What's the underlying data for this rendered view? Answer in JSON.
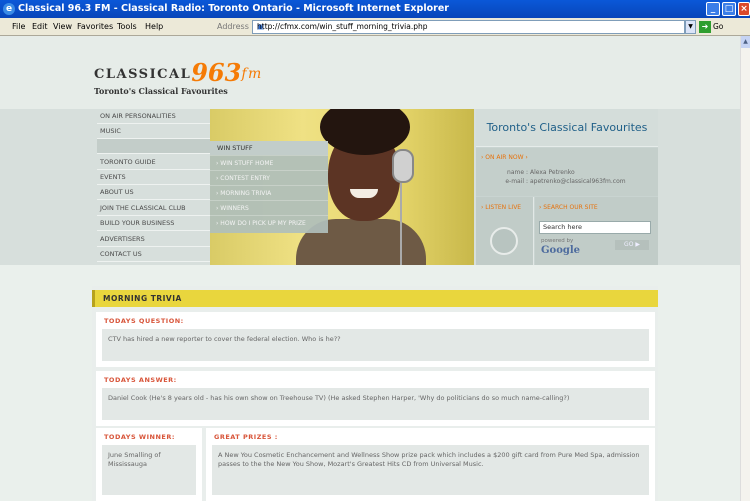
{
  "window": {
    "title": "Classical 96.3 FM - Classical Radio: Toronto Ontario - Microsoft Internet Explorer",
    "icon": "ie-icon"
  },
  "menubar": {
    "items": [
      "File",
      "Edit",
      "View",
      "Favorites",
      "Tools",
      "Help"
    ],
    "address_label": "Address",
    "address_url": "http://cfmx.com/win_stuff_morning_trivia.php",
    "go_label": "Go"
  },
  "logo": {
    "word": "CLASSICAL",
    "number": "963",
    "fm": "fm",
    "tagline": "Toronto's Classical Favourites"
  },
  "nav": {
    "items": [
      "ON AIR PERSONALITIES",
      "MUSIC",
      "",
      "TORONTO GUIDE",
      "EVENTS",
      "ABOUT US",
      "JOIN THE CLASSICAL CLUB",
      "BUILD YOUR BUSINESS",
      "ADVERTISERS",
      "CONTACT US"
    ]
  },
  "dropdown": {
    "title": "WIN STUFF",
    "items": [
      "› WIN STUFF HOME",
      "› CONTEST ENTRY",
      "› MORNING TRIVIA",
      "› WINNERS",
      "› HOW DO I PICK UP MY PRIZE"
    ]
  },
  "right_panel": {
    "title": "Toronto's Classical Favourites",
    "on_air_heading": "› ON AIR NOW ›",
    "name_label": "name :",
    "name_value": "Alexa Petrenko",
    "email_label": "e-mail :",
    "email_value": "apetrenko@classical963fm.com",
    "listen_live": "› LISTEN LIVE",
    "search_heading": "› SEARCH OUR SITE",
    "search_value": "Search here",
    "powered_by": "powered by",
    "google": "Google",
    "go_button": "GO ▶"
  },
  "content": {
    "section_title": "MORNING TRIVIA",
    "question_heading": "TODAYS QUESTION:",
    "question_text": "CTV has hired a new reporter to cover the federal election. Who is he??",
    "answer_heading": "TODAYS ANSWER:",
    "answer_text": "Daniel Cook (He's 8 years old - has his own show on Treehouse TV) (He asked Stephen Harper, 'Why do politicians do so much name-calling?)",
    "winner_heading": "TODAYS WINNER:",
    "winner_text": "June Smalling of Mississauga",
    "prizes_heading": "GREAT PRIZES :",
    "prizes_text": "A New You Cosmetic Enchancement and Wellness Show prize pack which includes a $200 gift card from Pure Med Spa, admission passes to the the New You Show, Mozart's Greatest Hits CD from Universal Music."
  },
  "colors": {
    "titlebar": "#0845b9",
    "accent_orange": "#f57b06",
    "trivia_bar": "#e9d63d",
    "heading_red": "#d8553a"
  }
}
